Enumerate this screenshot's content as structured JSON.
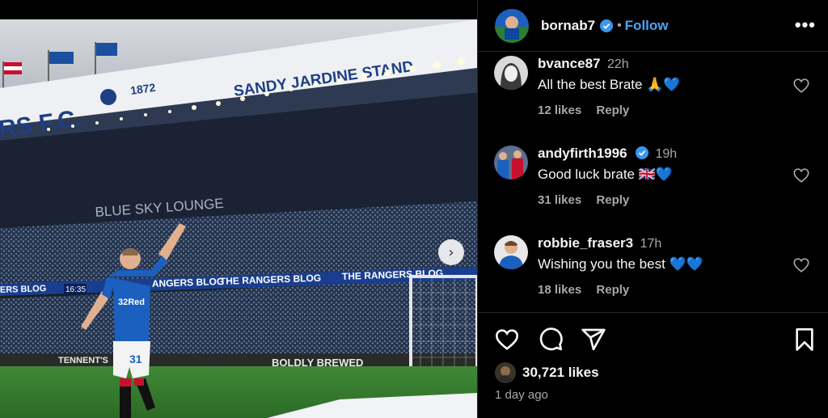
{
  "photo": {
    "stand_name": "SANDY JARDINE STAND",
    "club_text": "RS F.C.",
    "year": "1872",
    "lounge_sign": "BLUE SKY LOUNGE",
    "board_texts": [
      "ERS BLOG",
      "ANGERS BLOG",
      "THE RANGERS BLOG",
      "THE RANGERS BLOG"
    ],
    "clock": "16:35",
    "bottom_ads": [
      "TENNENT'S",
      "BOLDLY BREWED"
    ],
    "shirt_sponsor": "32Red",
    "shirt_number": "31",
    "next_icon": "chevron-right-icon"
  },
  "header": {
    "username": "bornab7",
    "verified": true,
    "separator": "•",
    "follow_label": "Follow",
    "more_label": "•••"
  },
  "comments": [
    {
      "user": "bvance87",
      "time": "22h",
      "text": "All the best Brate 🙏💙",
      "likes": "12 likes",
      "reply": "Reply",
      "verified": false
    },
    {
      "user": "andyfirth1996",
      "time": "19h",
      "text": "Good luck brate 🇬🇧💙",
      "likes": "31 likes",
      "reply": "Reply",
      "verified": true
    },
    {
      "user": "robbie_fraser3",
      "time": "17h",
      "text": "Wishing you the best 💙💙",
      "likes": "18 likes",
      "reply": "Reply",
      "verified": false
    }
  ],
  "actions": {
    "icons": [
      "heart-icon",
      "comment-icon",
      "share-icon",
      "bookmark-icon"
    ]
  },
  "post": {
    "likes": "30,721 likes",
    "date": "1 day ago"
  },
  "colors": {
    "accent": "#4ca3f7",
    "verified": "#3897f0",
    "rangers_blue": "#1b5fbf"
  }
}
